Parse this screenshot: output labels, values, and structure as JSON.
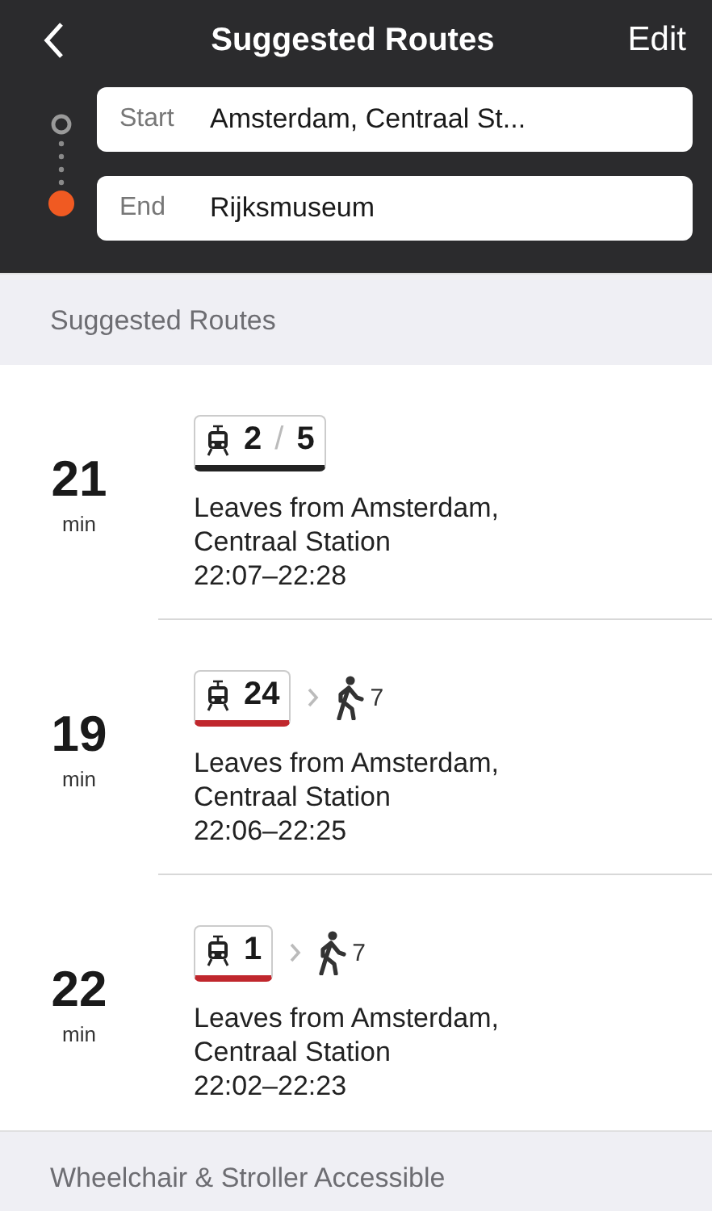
{
  "nav": {
    "title": "Suggested Routes",
    "action": "Edit"
  },
  "fields": [
    {
      "kind": "start",
      "label": "Start",
      "value": "Amsterdam, Centraal St..."
    },
    {
      "kind": "end",
      "label": "End",
      "value": "Rijksmuseum"
    }
  ],
  "sections": [
    {
      "title": "Suggested Routes",
      "routes": [
        {
          "minutes": "21",
          "unit": "min",
          "steps": [
            {
              "kind": "tram",
              "lines": [
                "2",
                "5"
              ],
              "separator": "/",
              "color": "#222222"
            }
          ],
          "details": [
            "Leaves from Amsterdam,",
            "Centraal Station",
            "22:07–22:28"
          ]
        },
        {
          "minutes": "19",
          "unit": "min",
          "steps": [
            {
              "kind": "tram",
              "lines": [
                "24"
              ],
              "color": "#c0272d"
            },
            {
              "kind": "walk",
              "minutes": "7"
            }
          ],
          "details": [
            "Leaves from Amsterdam,",
            "Centraal Station",
            "22:06–22:25"
          ]
        },
        {
          "minutes": "22",
          "unit": "min",
          "steps": [
            {
              "kind": "tram",
              "lines": [
                "1"
              ],
              "color": "#c0272d"
            },
            {
              "kind": "walk",
              "minutes": "7"
            }
          ],
          "details": [
            "Leaves from Amsterdam,",
            "Centraal Station",
            "22:02–22:23"
          ]
        }
      ]
    },
    {
      "title": "Wheelchair & Stroller Accessible"
    }
  ]
}
